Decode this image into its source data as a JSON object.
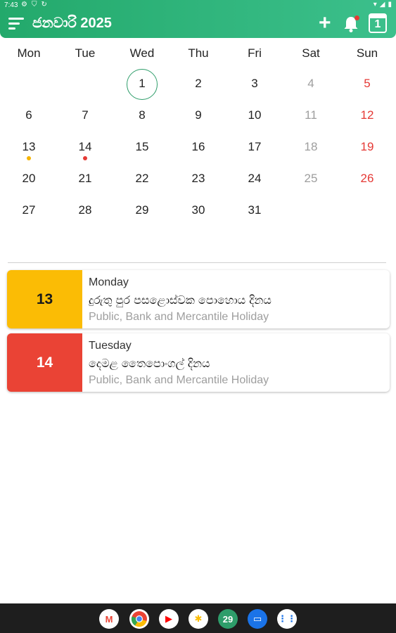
{
  "status_bar": {
    "time": "7:43",
    "left_icons": [
      "gear-icon",
      "shield-icon",
      "sync-icon"
    ],
    "right_icons": [
      "wifi-icon",
      "signal-icon",
      "battery-icon"
    ]
  },
  "header": {
    "title": "ජනවාරි 2025",
    "today_number": "1",
    "accent_start": "#23a96b",
    "accent_end": "#3cc08c"
  },
  "calendar": {
    "weekdays": [
      "Mon",
      "Tue",
      "Wed",
      "Thu",
      "Fri",
      "Sat",
      "Sun"
    ],
    "weeks": [
      [
        "",
        "",
        "1",
        "2",
        "3",
        "4",
        "5"
      ],
      [
        "6",
        "7",
        "8",
        "9",
        "10",
        "11",
        "12"
      ],
      [
        "13",
        "14",
        "15",
        "16",
        "17",
        "18",
        "19"
      ],
      [
        "20",
        "21",
        "22",
        "23",
        "24",
        "25",
        "26"
      ],
      [
        "27",
        "28",
        "29",
        "30",
        "31",
        "",
        ""
      ]
    ],
    "today": "1",
    "event_dots": {
      "13": "#f5b400",
      "14": "#e53935"
    }
  },
  "events": [
    {
      "day": "13",
      "weekday": "Monday",
      "name": "දුරුතු පුර පසළොස්වක පොහොය දිනය",
      "type": "Public, Bank and Mercantile Holiday",
      "color": "#fbbc05",
      "text_color": "#1a1a1a"
    },
    {
      "day": "14",
      "weekday": "Tuesday",
      "name": "දෙමළ තෛපොංගල් දිනය",
      "type": "Public, Bank and Mercantile Holiday",
      "color": "#ea4335",
      "text_color": "#ffffff"
    }
  ],
  "taskbar": {
    "apps": [
      {
        "name": "gmail-icon",
        "glyph": "M",
        "bg": "#ffffff",
        "fg": "#ea4335"
      },
      {
        "name": "chrome-icon",
        "glyph": "",
        "bg": "#ffffff",
        "fg": "#4285f4"
      },
      {
        "name": "youtube-icon",
        "glyph": "▶",
        "bg": "#ffffff",
        "fg": "#ff0000"
      },
      {
        "name": "photos-icon",
        "glyph": "✱",
        "bg": "#ffffff",
        "fg": "#fbbc05"
      },
      {
        "name": "calendar-app-icon",
        "glyph": "29",
        "bg": "#2e9d6a",
        "fg": "#ffffff"
      },
      {
        "name": "messages-icon",
        "glyph": "▭",
        "bg": "#1a73e8",
        "fg": "#ffffff"
      },
      {
        "name": "app-drawer-icon",
        "glyph": "⋮⋮",
        "bg": "#ffffff",
        "fg": "#1a73e8"
      }
    ]
  }
}
